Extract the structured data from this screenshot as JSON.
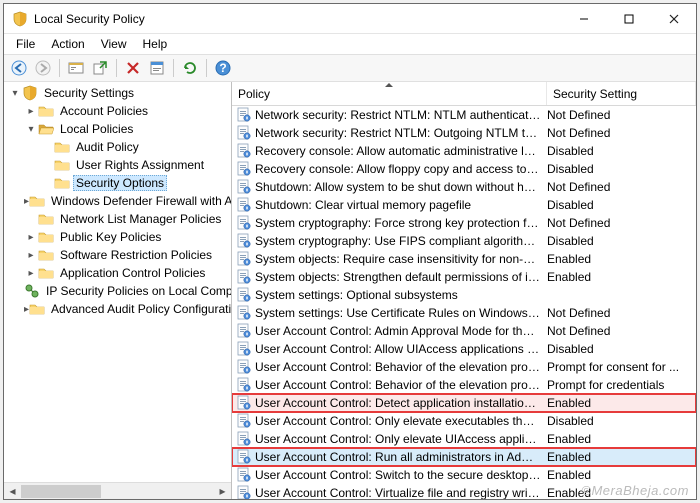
{
  "window": {
    "title": "Local Security Policy"
  },
  "menu": {
    "file": "File",
    "action": "Action",
    "view": "View",
    "help": "Help"
  },
  "tree": {
    "root": "Security Settings",
    "account_policies": "Account Policies",
    "local_policies": "Local Policies",
    "audit_policy": "Audit Policy",
    "user_rights": "User Rights Assignment",
    "security_options": "Security Options",
    "firewall": "Windows Defender Firewall with Adva",
    "nlm": "Network List Manager Policies",
    "pubkey": "Public Key Policies",
    "srp": "Software Restriction Policies",
    "acp": "Application Control Policies",
    "ipsec": "IP Security Policies on Local Compute",
    "audit_conf": "Advanced Audit Policy Configuration"
  },
  "columns": {
    "policy": "Policy",
    "setting": "Security Setting"
  },
  "policies": [
    {
      "name": "Network security: Restrict NTLM: NTLM authentication in th...",
      "setting": "Not Defined"
    },
    {
      "name": "Network security: Restrict NTLM: Outgoing NTLM traffic to ...",
      "setting": "Not Defined"
    },
    {
      "name": "Recovery console: Allow automatic administrative logon",
      "setting": "Disabled"
    },
    {
      "name": "Recovery console: Allow floppy copy and access to all drives...",
      "setting": "Disabled"
    },
    {
      "name": "Shutdown: Allow system to be shut down without having to...",
      "setting": "Not Defined"
    },
    {
      "name": "Shutdown: Clear virtual memory pagefile",
      "setting": "Disabled"
    },
    {
      "name": "System cryptography: Force strong key protection for user k...",
      "setting": "Not Defined"
    },
    {
      "name": "System cryptography: Use FIPS compliant algorithms for en...",
      "setting": "Disabled"
    },
    {
      "name": "System objects: Require case insensitivity for non-Windows ...",
      "setting": "Enabled"
    },
    {
      "name": "System objects: Strengthen default permissions of internal s...",
      "setting": "Enabled"
    },
    {
      "name": "System settings: Optional subsystems",
      "setting": ""
    },
    {
      "name": "System settings: Use Certificate Rules on Windows Executabl...",
      "setting": "Not Defined"
    },
    {
      "name": "User Account Control: Admin Approval Mode for the Built-i...",
      "setting": "Not Defined"
    },
    {
      "name": "User Account Control: Allow UIAccess applications to prom...",
      "setting": "Disabled"
    },
    {
      "name": "User Account Control: Behavior of the elevation prompt for ...",
      "setting": "Prompt for consent for ..."
    },
    {
      "name": "User Account Control: Behavior of the elevation prompt for ...",
      "setting": "Prompt for credentials"
    },
    {
      "name": "User Account Control: Detect application installations and p...",
      "setting": "Enabled",
      "hl": 1
    },
    {
      "name": "User Account Control: Only elevate executables that are sign...",
      "setting": "Disabled"
    },
    {
      "name": "User Account Control: Only elevate UIAccess applications th...",
      "setting": "Enabled"
    },
    {
      "name": "User Account Control: Run all administrators in Admin Appr...",
      "setting": "Enabled",
      "hl": 2
    },
    {
      "name": "User Account Control: Switch to the secure desktop when pr...",
      "setting": "Enabled"
    },
    {
      "name": "User Account Control: Virtualize file and registry write failure...",
      "setting": "Enabled"
    }
  ],
  "watermark": "©MeraBheja.com"
}
